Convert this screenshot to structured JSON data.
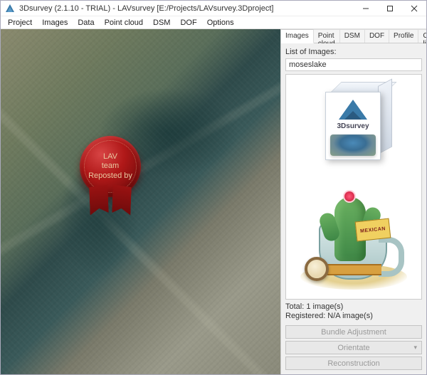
{
  "titlebar": {
    "title": "3Dsurvey (2.1.10 - TRIAL) - LAVsurvey [E:/Projects/LAVsurvey.3Dproject]"
  },
  "menu": {
    "items": [
      "Project",
      "Images",
      "Data",
      "Point cloud",
      "DSM",
      "DOF",
      "Options"
    ]
  },
  "seal": {
    "line1": "LAV",
    "line2": "team",
    "line3": "Reposted by"
  },
  "sidepanel": {
    "tabs": [
      "Images",
      "Point cloud",
      "DSM",
      "DOF",
      "Profile",
      "Contour lines"
    ],
    "active_tab_index": 0,
    "list_label": "List of Images:",
    "selected_image": "moseslake",
    "box_brand": "3Dsurvey",
    "sign_text": "MEXICAN",
    "total_line": "Total: 1 image(s)",
    "registered_line": "Registered: N/A image(s)"
  },
  "actions": {
    "bundle": "Bundle Adjustment",
    "orientate": "Orientate",
    "reconstruction": "Reconstruction"
  }
}
